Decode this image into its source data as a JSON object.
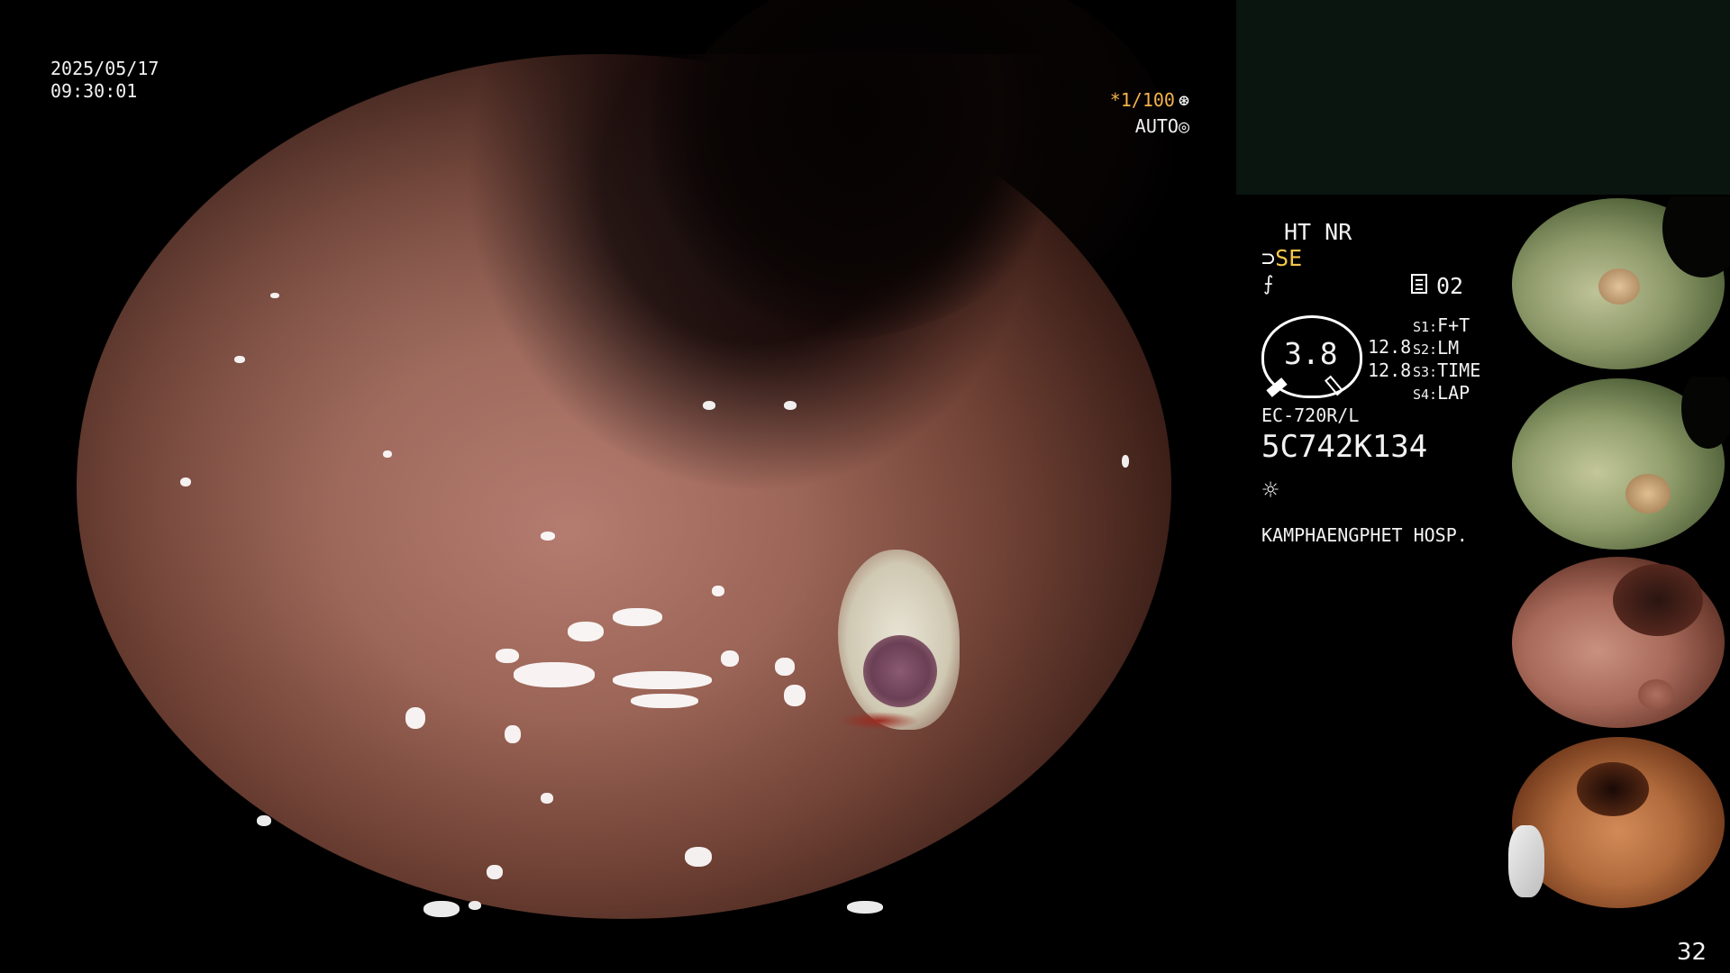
{
  "timestamp": {
    "date": "2025/05/17",
    "time": "09:30:01"
  },
  "image_params": {
    "shutter": "*1/100",
    "shutter_icon": "aperture-icon",
    "exposure": "AUTO",
    "exposure_icon": "auto-iris-icon"
  },
  "enhancement": {
    "mode_line": "HT NR",
    "structure_icon": "structure-enhance-icon",
    "se_label": "SE",
    "edge_icon": "edge-enhance-icon"
  },
  "page_indicator": {
    "icon": "page-counter-icon",
    "value": "02"
  },
  "gauge": {
    "value": "3.8",
    "ratio_1": "12.8",
    "ratio_2": "12.8"
  },
  "switches": [
    {
      "key": "S1:",
      "value": "F+T"
    },
    {
      "key": "S2:",
      "value": "LM"
    },
    {
      "key": "S3:",
      "value": "TIME"
    },
    {
      "key": "S4:",
      "value": "LAP"
    }
  ],
  "scope": {
    "model": "EC-720R/L",
    "serial": "5C742K134",
    "light_icon": "light-source-icon"
  },
  "hospital": "KAMPHAENGPHET HOSP.",
  "colors": {
    "shutter_accent": "#f6b24a",
    "se_accent": "#f6c74a",
    "panel_box": "#0a1510"
  },
  "thumbnails": [
    {
      "name": "captured-image-1"
    },
    {
      "name": "captured-image-2"
    },
    {
      "name": "captured-image-3"
    },
    {
      "name": "captured-image-4"
    }
  ],
  "slide_number": "32"
}
